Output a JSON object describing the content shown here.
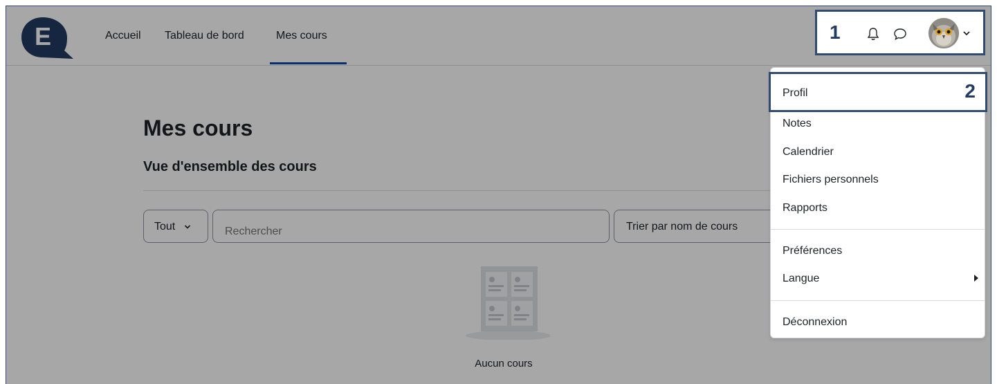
{
  "nav": {
    "logo_letter": "E",
    "links": [
      "Accueil",
      "Tableau de bord",
      "Mes cours"
    ],
    "active": "Mes cours",
    "marker": "1"
  },
  "main": {
    "title": "Mes cours",
    "section_title": "Vue d'ensemble des cours",
    "filter_value": "Tout",
    "search_placeholder": "Rechercher",
    "sort_value": "Trier par nom de cours",
    "empty_text": "Aucun cours"
  },
  "dropdown": {
    "marker": "2",
    "items": {
      "profile": "Profil",
      "grades": "Notes",
      "calendar": "Calendrier",
      "files": "Fichiers personnels",
      "reports": "Rapports",
      "preferences": "Préférences",
      "language": "Langue",
      "logout": "Déconnexion"
    }
  },
  "colors": {
    "brand": "#233b63",
    "active_tab": "#0f47ad",
    "highlight_border": "#2f4a73"
  },
  "icons": [
    "bell-icon",
    "chat-icon",
    "chevron-down-icon",
    "caret-right-icon"
  ]
}
